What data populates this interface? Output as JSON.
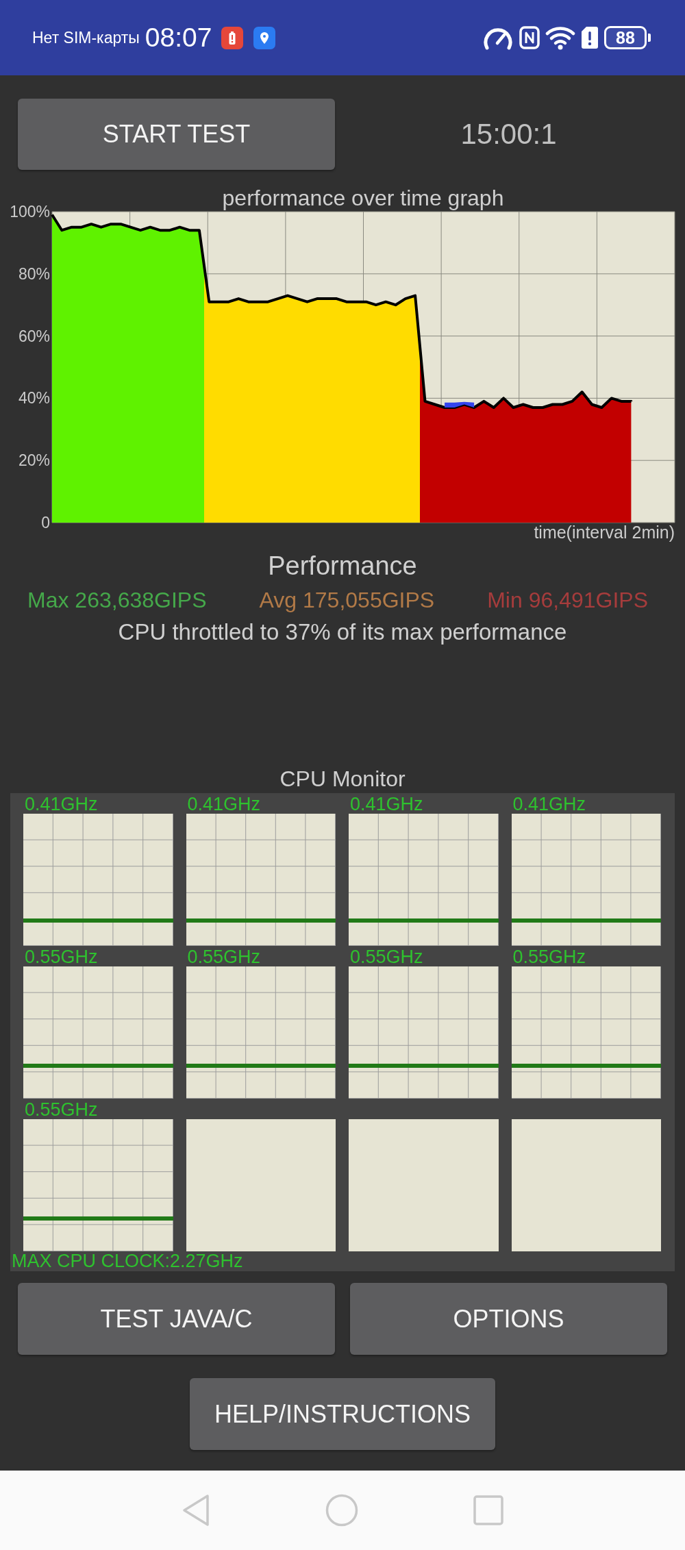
{
  "status_bar": {
    "carrier": "Нет SIM-карты",
    "time": "08:07",
    "battery": "88"
  },
  "controls": {
    "start_button": "START TEST",
    "timer": "15:00:1"
  },
  "performance_graph": {
    "chart_data": {
      "type": "area",
      "title": "performance over time graph",
      "xlabel": "time(interval 2min)",
      "grid": true,
      "stacked": true,
      "categories": [
        null,
        null,
        null,
        null,
        null,
        null,
        null,
        null,
        null,
        null,
        null,
        null,
        null,
        null,
        null,
        null,
        null,
        null,
        null,
        null,
        null,
        null,
        null,
        null,
        null,
        null,
        null,
        null,
        null,
        null,
        null,
        null,
        null,
        null,
        null,
        null,
        null,
        null,
        null,
        null,
        null,
        null,
        null,
        null,
        null,
        null,
        null,
        null,
        null,
        null,
        null,
        null,
        null,
        null,
        null,
        null,
        null,
        null,
        null,
        null
      ],
      "series": [
        {
          "color": "#000000",
          "values": [
            99,
            94,
            95,
            95,
            96,
            95,
            96,
            96,
            95,
            94,
            95,
            94,
            94,
            95,
            94,
            94,
            71,
            71,
            71,
            72,
            71,
            71,
            71,
            72,
            73,
            72,
            71,
            72,
            72,
            72,
            71,
            71,
            71,
            70,
            71,
            70,
            72,
            73,
            39,
            38,
            37,
            37,
            38,
            37,
            39,
            37,
            40,
            37,
            38,
            37,
            37,
            38,
            38,
            39,
            42,
            38,
            37,
            40,
            39,
            39
          ]
        },
        {
          "color": "#3344ee",
          "values": [
            null,
            null,
            null,
            null,
            null,
            null,
            null,
            null,
            null,
            null,
            null,
            null,
            null,
            null,
            null,
            null,
            null,
            null,
            null,
            null,
            null,
            null,
            null,
            null,
            null,
            null,
            null,
            null,
            null,
            null,
            null,
            null,
            null,
            null,
            null,
            null,
            null,
            null,
            null,
            null,
            1.6,
            1.6,
            0.8,
            1.6,
            null,
            null,
            null,
            null,
            null,
            null,
            null,
            null,
            null,
            null,
            null,
            null,
            null,
            null,
            null,
            null
          ]
        }
      ],
      "ylim": [
        0,
        100
      ],
      "yticks": [
        {
          "value": 0,
          "label": "0"
        },
        {
          "value": 20,
          "label": "20%"
        },
        {
          "value": 40,
          "label": "40%"
        },
        {
          "value": 60,
          "label": "60%"
        },
        {
          "value": 80,
          "label": "80%"
        },
        {
          "value": 100,
          "label": "100%"
        }
      ]
    }
  },
  "performance": {
    "title": "Performance",
    "stats": [
      {
        "text": "Max 263,638GIPS",
        "color": "#45a84a"
      },
      {
        "text": "Avg 175,055GIPS",
        "color": "#b27a47"
      },
      {
        "text": "Min 96,491GIPS",
        "color": "#a63c3c"
      }
    ],
    "summary": "CPU throttled to 37% of its max performance"
  },
  "cpu_monitor": {
    "title": "CPU Monitor",
    "cores": [
      {
        "active": true,
        "label": "0.41GHz"
      },
      {
        "active": true,
        "label": "0.41GHz"
      },
      {
        "active": true,
        "label": "0.41GHz"
      },
      {
        "active": true,
        "label": "0.41GHz"
      },
      {
        "active": true,
        "label": "0.55GHz"
      },
      {
        "active": true,
        "label": "0.55GHz"
      },
      {
        "active": true,
        "label": "0.55GHz"
      },
      {
        "active": true,
        "label": "0.55GHz"
      },
      {
        "active": true,
        "label": "0.55GHz"
      },
      {
        "active": false
      },
      {
        "active": false
      },
      {
        "active": false
      }
    ],
    "max_clock": "MAX CPU CLOCK:2.27GHz"
  },
  "buttons": {
    "test": "TEST JAVA/C",
    "options": "OPTIONS",
    "help": "HELP/INSTRUCTIONS"
  }
}
